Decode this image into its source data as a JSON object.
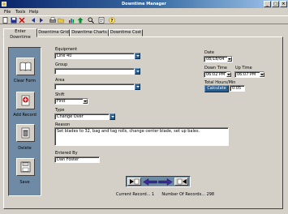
{
  "window": {
    "title": "Downtime Manager"
  },
  "menu": [
    "File",
    "Tools",
    "Help"
  ],
  "toolbar_icons": [
    "new-icon",
    "save-icon",
    "delete-icon",
    "back-icon",
    "forward-icon",
    "print-icon",
    "folder-icon",
    "chart-icon",
    "up-icon",
    "search-icon",
    "report-icon",
    "help-icon"
  ],
  "tabs": [
    "Enter Downtime",
    "Downtime Grid",
    "Downtime Charts",
    "Downtime Cost"
  ],
  "sidebar": {
    "clear_form": "Clear Form",
    "add_record": "Add Record",
    "delete": "Delete",
    "save": "Save"
  },
  "form": {
    "equipment_label": "Equipment",
    "equipment_value": "Line 40",
    "group_label": "Group",
    "group_value": "",
    "area_label": "Area",
    "area_value": "",
    "shift_label": "Shift",
    "shift_value": "First",
    "type_label": "Type",
    "type_value": "Change Over",
    "reason_label": "Reason",
    "reason_value": "Set blades to 32, bag and tag rolls, change center blade, set up bales.",
    "entered_by_label": "Entered By",
    "entered_by_value": "Dan Foster",
    "date_label": "Date",
    "date_value": "08/18/04",
    "down_time_label": "Down Time",
    "down_time_value": "06:02 PM",
    "up_time_label": "Up Time",
    "up_time_value": "06:07 PM",
    "total_hours_label": "Total Hours/Min",
    "calculate_label": "Calculate",
    "total_value": "0:05"
  },
  "status": {
    "current_record": "Current Record... 1",
    "number_of_records": "Number Of Records... 298"
  },
  "colors": {
    "accent_blue": "#2c5e8c",
    "sidebar_bg": "#6e8aa4",
    "window_bg": "#d4d0c8",
    "nav_arrow": "#3a2a9c"
  }
}
